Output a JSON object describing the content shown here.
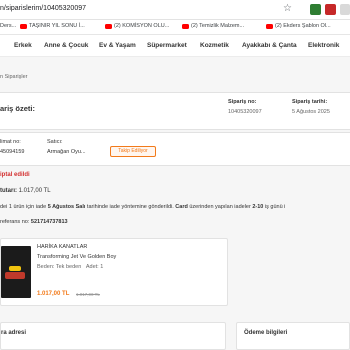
{
  "browser": {
    "url": "n/siparislerim/10405320097",
    "bookmarks": [
      "Ders...",
      "TAŞINIR YIL SONU İ...",
      "(2) KOMİSYON OLU...",
      "(2) Temizlik Malzem...",
      "(2) Ekders Şablon Ol..."
    ]
  },
  "nav": {
    "categories": [
      "Erkek",
      "Anne & Çocuk",
      "Ev & Yaşam",
      "Süpermarket",
      "Kozmetik",
      "Ayakkabı & Çanta",
      "Elektronik"
    ]
  },
  "breadcrumb": "n Siparişler",
  "order": {
    "summary_title": "ariş özeti:",
    "order_no_label": "Sipariş no:",
    "order_no": "10405320097",
    "order_date_label": "Sipariş tarihi:",
    "order_date": "5 Ağustos 2025",
    "shipment_no_label": "limat no:",
    "shipment_no": "45094159",
    "seller_label": "Satıcı:",
    "seller": "Armağan Oyu...",
    "follow_button": "Takip Ediliyor"
  },
  "cancel": {
    "status": "iptal edildi",
    "refund_label": "tutarı:",
    "refund_amount": "1.017,00 TL",
    "note_prefix": "dei 1 ürün için iade ",
    "note_date": "5 Ağustos Salı",
    "note_mid": " tarihinde iade yöntemine gönderildi. ",
    "note_card": "Card",
    "note_suffix": " üzerinden yapılan iadeler ",
    "note_days": "2-10",
    "note_end": " iş günü i",
    "ref_label": "referans no: ",
    "ref_no": "521714737813"
  },
  "product": {
    "brand": "HARİKA KANATLAR",
    "name": "Transforming Jet Ve Golden Boy",
    "size_label": "Beden: ",
    "size": "Tek beden",
    "qty_label": "Adet: ",
    "qty": "1",
    "price": "1.017,00 TL",
    "old_price": "1.017,00 TL"
  },
  "sections": {
    "address_title": "ra adresi",
    "payment_title": "Ödeme bilgileri"
  },
  "colors": {
    "accent": "#f27a1a",
    "cancel": "#d32f2f"
  }
}
